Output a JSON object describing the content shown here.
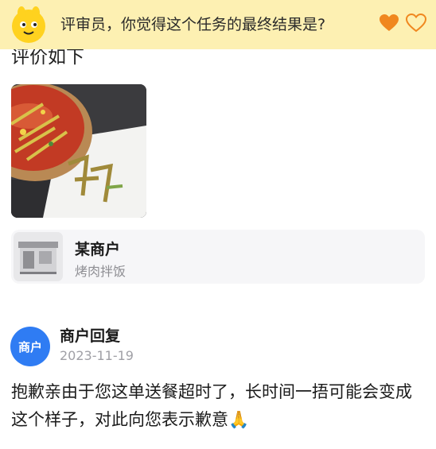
{
  "banner": {
    "question": "评审员，你觉得这个任务的最终结果是?",
    "mascot_icon": "yellow-mascot-icon",
    "like_icon": "heart-filled-icon",
    "like_outline_icon": "heart-outline-icon",
    "accent_color": "#f0871f",
    "background_color": "#fdf0b2"
  },
  "review": {
    "cutoff_text": "评价如下"
  },
  "merchant": {
    "name": "某商户",
    "category": "烤肉拌饭",
    "icon": "storefront-icon"
  },
  "reply": {
    "avatar_label": "商户",
    "title": "商户回复",
    "date": "2023-11-19",
    "body": "抱歉亲由于您这单送餐超时了，长时间一捂可能会变成这个样子，对此向您表示歉意",
    "emoji": "🙏",
    "avatar_color": "#2f7cf3"
  }
}
